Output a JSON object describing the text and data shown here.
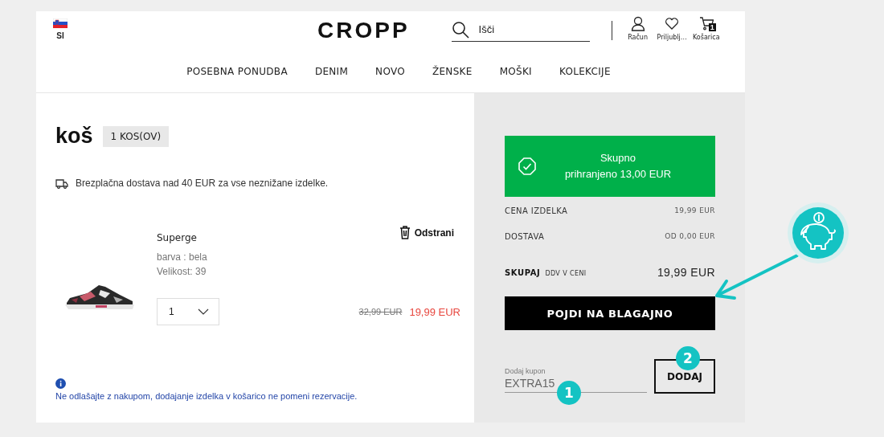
{
  "header": {
    "locale": "SI",
    "logo": "CROPP",
    "search": {
      "placeholder": "Išči"
    },
    "account_links": [
      {
        "kind": "user",
        "label": "Račun"
      },
      {
        "kind": "heart",
        "label": "Priljublj…"
      },
      {
        "kind": "cart",
        "label": "Košarica",
        "count": "1"
      }
    ]
  },
  "nav": [
    "POSEBNA PONUDBA",
    "DENIM",
    "NOVO",
    "ŽENSKE",
    "MOŠKI",
    "KOLEKCIJE"
  ],
  "cart": {
    "title": "koš",
    "count_badge": "1 KOS(OV)",
    "shipping_note": "Brezplačna dostava nad 40 EUR za vse neznižane izdelke.",
    "items": [
      {
        "name": "Superge",
        "color_line": "barva : bela",
        "size_line": "Velikost: 39",
        "quantity": "1",
        "remove": "Odstrani",
        "old_price": "32,99 EUR",
        "price": "19,99 EUR"
      }
    ],
    "notice": "Ne odlašajte z nakupom, dodajanje izdelka v košarico ne pomeni rezervacije."
  },
  "summary": {
    "savings_banner": {
      "title": "Skupno",
      "text": "prihranjeno 13,00 EUR"
    },
    "rows": [
      {
        "kind": "plain",
        "label": "CENA IZDELKA",
        "value": "19,99 EUR"
      },
      {
        "kind": "plain",
        "label": "DOSTAVA",
        "value": "OD 0,00 EUR"
      },
      {
        "kind": "total",
        "label": "SKUPAJ",
        "note": "DDV V CENI",
        "value": "19,99 EUR"
      }
    ],
    "checkout_button": "POJDI NA BLAGAJNO",
    "coupon": {
      "label": "Dodaj kupon",
      "value": "EXTRA15",
      "button": "DODAJ",
      "field_step": "1",
      "button_step": "2"
    }
  }
}
